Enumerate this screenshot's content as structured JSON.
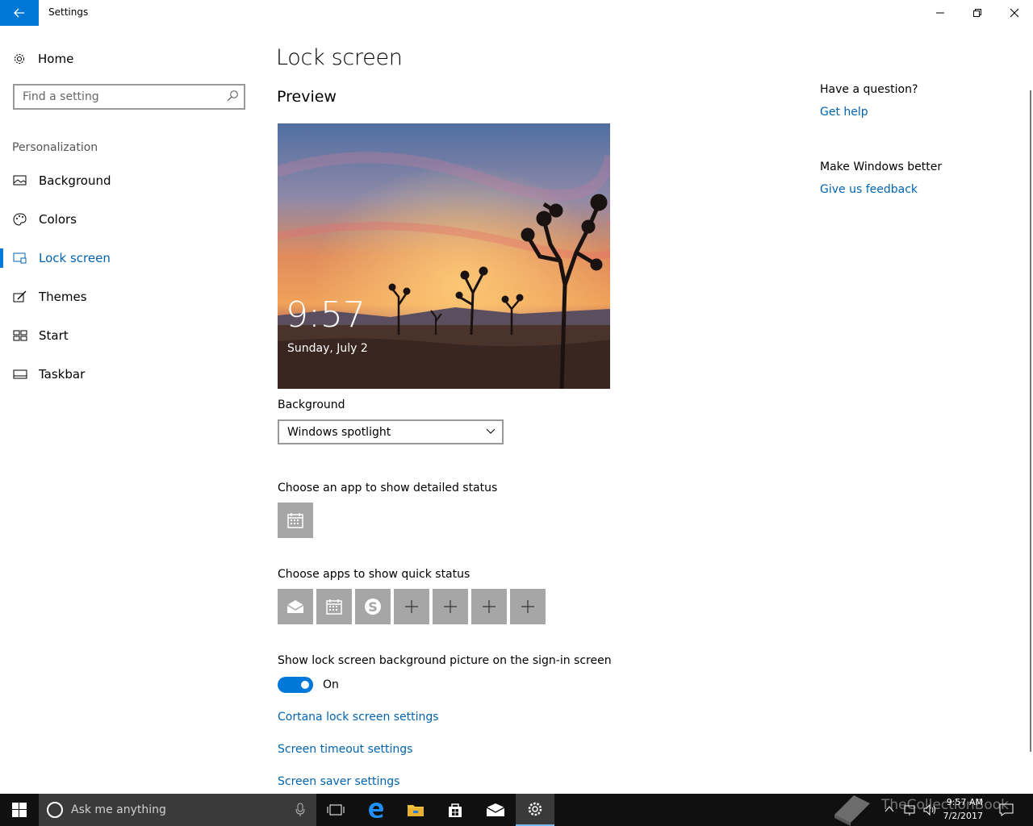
{
  "titlebar": {
    "title": "Settings",
    "back_icon": "arrow-left-icon",
    "minimize_icon": "minimize-icon",
    "restore_icon": "restore-icon",
    "close_icon": "close-icon",
    "accent_color": "#0078d7"
  },
  "sidebar": {
    "home_label": "Home",
    "search_placeholder": "Find a setting",
    "section": "Personalization",
    "items": [
      {
        "label": "Background",
        "icon": "picture-icon"
      },
      {
        "label": "Colors",
        "icon": "palette-icon"
      },
      {
        "label": "Lock screen",
        "icon": "lock-screen-icon",
        "active": true
      },
      {
        "label": "Themes",
        "icon": "themes-icon"
      },
      {
        "label": "Start",
        "icon": "start-icon"
      },
      {
        "label": "Taskbar",
        "icon": "taskbar-icon"
      }
    ]
  },
  "main": {
    "title": "Lock screen",
    "preview_heading": "Preview",
    "preview_time": "9:57",
    "preview_date": "Sunday, July 2",
    "background_label": "Background",
    "background_value": "Windows spotlight",
    "detailed_status_label": "Choose an app to show detailed status",
    "detailed_status_app": "calendar-icon",
    "quick_status_label": "Choose apps to show quick status",
    "quick_status_apps": [
      "mail-icon",
      "calendar-icon",
      "skype-icon",
      "plus-icon",
      "plus-icon",
      "plus-icon",
      "plus-icon"
    ],
    "signin_label": "Show lock screen background picture on the sign-in screen",
    "signin_toggle": "On",
    "links": [
      "Cortana lock screen settings",
      "Screen timeout settings",
      "Screen saver settings"
    ]
  },
  "aside": {
    "question_heading": "Have a question?",
    "help_link": "Get help",
    "feedback_heading": "Make Windows better",
    "feedback_link": "Give us feedback"
  },
  "taskbar": {
    "search_text": "Ask me anything",
    "time": "9:57 AM",
    "date": "7/2/2017",
    "watermark": "TheCollectionBook"
  }
}
